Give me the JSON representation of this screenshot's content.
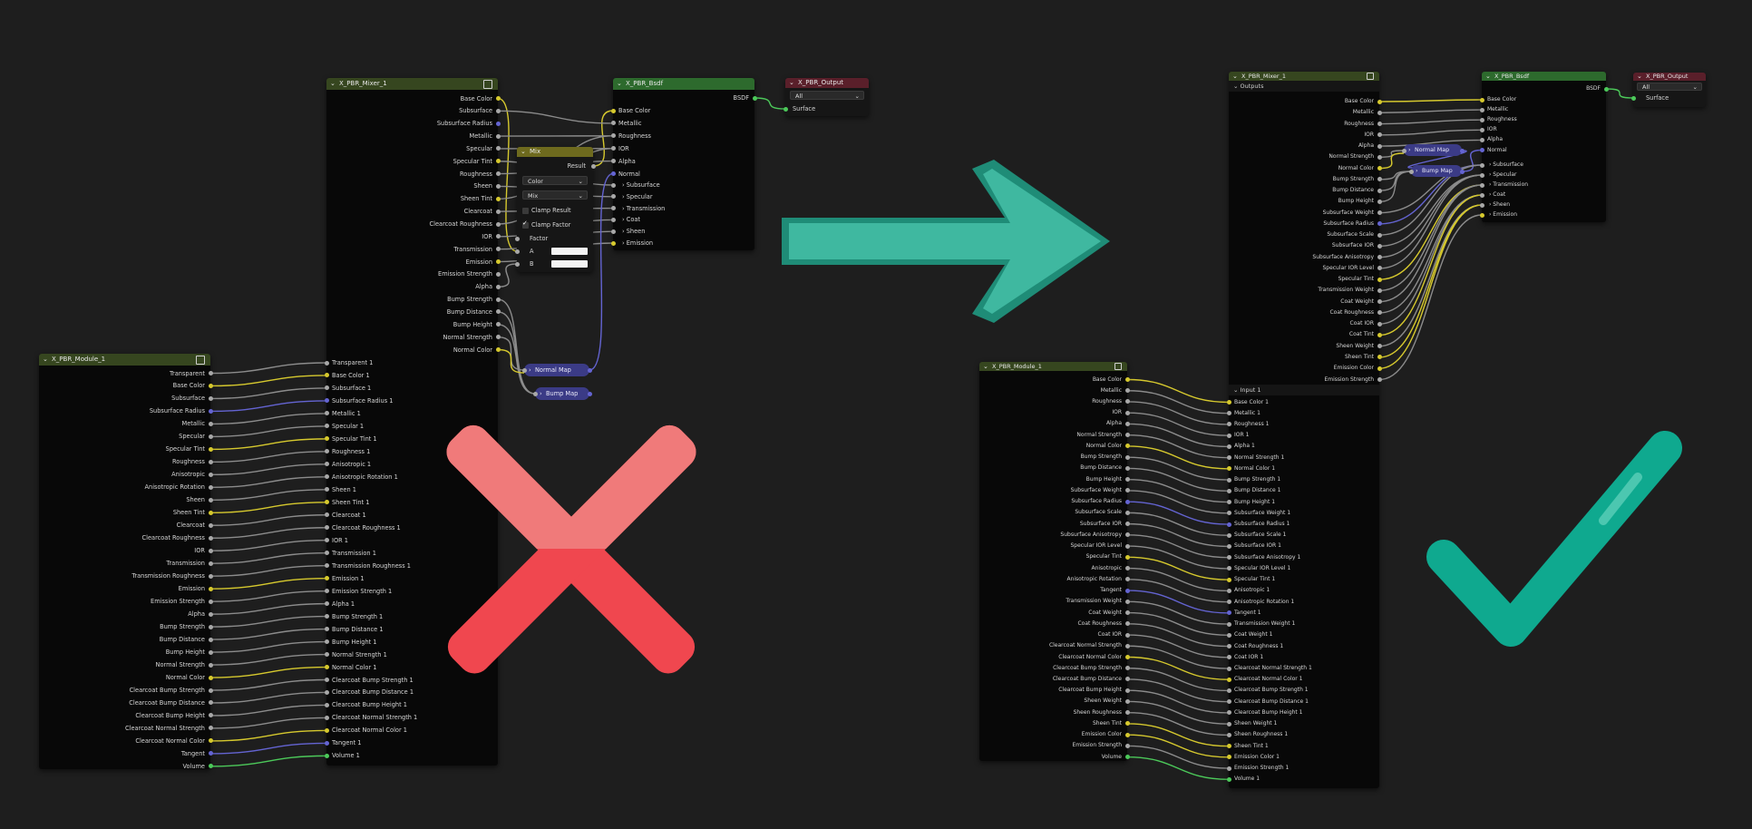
{
  "colors": {
    "background": "#1e1e1e",
    "node_body": "#080808",
    "group_header": "#36461f",
    "shader_header": "#2d6a2d",
    "output_header": "#5a1f2a",
    "mix_header": "#6e6a1e",
    "vector_node": "#3b3b86",
    "socket_color": "#d6c92e",
    "socket_float": "#a8a8a8",
    "socket_vector": "#6464d2",
    "socket_shader": "#4cc95a",
    "arrow": "#3fb8a0",
    "cross_top": "#f07a7a",
    "cross_bottom": "#f0474f",
    "check": "#0fa98f"
  },
  "icons": {
    "arrow": "right-arrow-icon",
    "cross": "cross-icon",
    "check": "checkmark-icon"
  },
  "left": {
    "module": {
      "title": "X_PBR_Module_1",
      "outputs": [
        "Transparent",
        "Base Color",
        "Subsurface",
        "Subsurface Radius",
        "Metallic",
        "Specular",
        "Specular Tint",
        "Roughness",
        "Anisotropic",
        "Anisotropic Rotation",
        "Sheen",
        "Sheen Tint",
        "Clearcoat",
        "Clearcoat Roughness",
        "IOR",
        "Transmission",
        "Transmission Roughness",
        "Emission",
        "Emission Strength",
        "Alpha",
        "Bump Strength",
        "Bump Distance",
        "Bump Height",
        "Normal Strength",
        "Normal Color",
        "Clearcoat Bump Strength",
        "Clearcoat Bump Distance",
        "Clearcoat Bump Height",
        "Clearcoat Normal Strength",
        "Clearcoat Normal Color",
        "Tangent",
        "Volume"
      ]
    },
    "mixer": {
      "title": "X_PBR_Mixer_1",
      "outputs": [
        "Base Color",
        "Subsurface",
        "Subsurface Radius",
        "Metallic",
        "Specular",
        "Specular Tint",
        "Roughness",
        "Sheen",
        "Sheen Tint",
        "Clearcoat",
        "Clearcoat Roughness",
        "IOR",
        "Transmission",
        "Emission",
        "Emission Strength",
        "Alpha",
        "Bump Strength",
        "Bump Distance",
        "Bump Height",
        "Normal Strength",
        "Normal Color"
      ],
      "inputs": [
        "Transparent 1",
        "Base Color 1",
        "Subsurface 1",
        "Subsurface Radius 1",
        "Metallic 1",
        "Specular 1",
        "Specular Tint 1",
        "Roughness 1",
        "Anisotropic 1",
        "Anisotropic Rotation 1",
        "Sheen 1",
        "Sheen Tint 1",
        "Clearcoat 1",
        "Clearcoat Roughness 1",
        "IOR 1",
        "Transmission 1",
        "Transmission Roughness 1",
        "Emission 1",
        "Emission Strength 1",
        "Alpha 1",
        "Bump Strength 1",
        "Bump Distance 1",
        "Bump Height 1",
        "Normal Strength 1",
        "Normal Color 1",
        "Clearcoat Bump Strength 1",
        "Clearcoat Bump Distance 1",
        "Clearcoat Bump Height 1",
        "Clearcoat Normal Strength 1",
        "Clearcoat Normal Color 1",
        "Tangent 1",
        "Volume 1"
      ]
    },
    "mix": {
      "title": "Mix",
      "result": "Result",
      "data_type": "Color",
      "blend_mode": "Mix",
      "clamp_result_label": "Clamp Result",
      "clamp_result": false,
      "clamp_factor_label": "Clamp Factor",
      "clamp_factor": true,
      "factor": "Factor",
      "a": "A",
      "b": "B"
    },
    "bsdf": {
      "title": "X_PBR_Bsdf",
      "output": "BSDF",
      "inputs": [
        "Base Color",
        "Metallic",
        "Roughness",
        "IOR",
        "Alpha",
        "Normal"
      ],
      "panels": [
        "Subsurface",
        "Specular",
        "Transmission",
        "Coat",
        "Sheen",
        "Emission"
      ]
    },
    "output": {
      "title": "X_PBR_Output",
      "target": "All",
      "input": "Surface"
    },
    "normal_map": "Normal Map",
    "bump_map": "Bump Map"
  },
  "right": {
    "mixer": {
      "title": "X_PBR_Mixer_1",
      "outputs_panel": "Outputs",
      "outputs": [
        "Base Color",
        "Metallic",
        "Roughness",
        "IOR",
        "Alpha",
        "Normal Strength",
        "Normal Color",
        "Bump Strength",
        "Bump Distance",
        "Bump Height",
        "Subsurface Weight",
        "Subsurface Radius",
        "Subsurface Scale",
        "Subsurface IOR",
        "Subsurface Anisotropy",
        "Specular IOR Level",
        "Specular Tint",
        "Transmission Weight",
        "Coat Weight",
        "Coat Roughness",
        "Coat IOR",
        "Coat Tint",
        "Sheen Weight",
        "Sheen Tint",
        "Emission Color",
        "Emission Strength"
      ],
      "input_panel": "Input 1",
      "inputs": [
        "Base Color 1",
        "Metallic 1",
        "Roughness 1",
        "IOR 1",
        "Alpha 1",
        "Normal Strength 1",
        "Normal Color 1",
        "Bump Strength 1",
        "Bump Distance 1",
        "Bump Height 1",
        "Subsurface Weight 1",
        "Subsurface Radius 1",
        "Subsurface Scale 1",
        "Subsurface IOR 1",
        "Subsurface Anisotropy 1",
        "Specular IOR Level 1",
        "Specular Tint 1",
        "Anisotropic 1",
        "Anisotropic Rotation 1",
        "Tangent 1",
        "Transmission Weight 1",
        "Coat Weight 1",
        "Coat Roughness 1",
        "Coat IOR 1",
        "Clearcoat Normal Strength 1",
        "Clearcoat Normal Color 1",
        "Clearcoat Bump Strength 1",
        "Clearcoat Bump Distance 1",
        "Clearcoat Bump Height 1",
        "Sheen Weight 1",
        "Sheen Roughness 1",
        "Sheen Tint 1",
        "Emission Color 1",
        "Emission Strength 1",
        "Volume 1"
      ]
    },
    "module": {
      "title": "X_PBR_Module_1",
      "outputs": [
        "Base Color",
        "Metallic",
        "Roughness",
        "IOR",
        "Alpha",
        "Normal Strength",
        "Normal Color",
        "Bump Strength",
        "Bump Distance",
        "Bump Height",
        "Subsurface Weight",
        "Subsurface Radius",
        "Subsurface Scale",
        "Subsurface IOR",
        "Subsurface Anisotropy",
        "Specular IOR Level",
        "Specular Tint",
        "Anisotropic",
        "Anisotropic Rotation",
        "Tangent",
        "Transmission Weight",
        "Coat Weight",
        "Coat Roughness",
        "Coat IOR",
        "Clearcoat Normal Strength",
        "Clearcoat Normal Color",
        "Clearcoat Bump Strength",
        "Clearcoat Bump Distance",
        "Clearcoat Bump Height",
        "Sheen Weight",
        "Sheen Roughness",
        "Sheen Tint",
        "Emission Color",
        "Emission Strength",
        "Volume"
      ]
    },
    "bsdf": {
      "title": "X_PBR_Bsdf",
      "output": "BSDF",
      "inputs": [
        "Base Color",
        "Metallic",
        "Roughness",
        "IOR",
        "Alpha",
        "Normal"
      ],
      "panels": [
        "Subsurface",
        "Specular",
        "Transmission",
        "Coat",
        "Sheen",
        "Emission"
      ]
    },
    "output": {
      "title": "X_PBR_Output",
      "target": "All",
      "input": "Surface"
    },
    "normal_map": "Normal Map",
    "bump_map": "Bump Map"
  }
}
